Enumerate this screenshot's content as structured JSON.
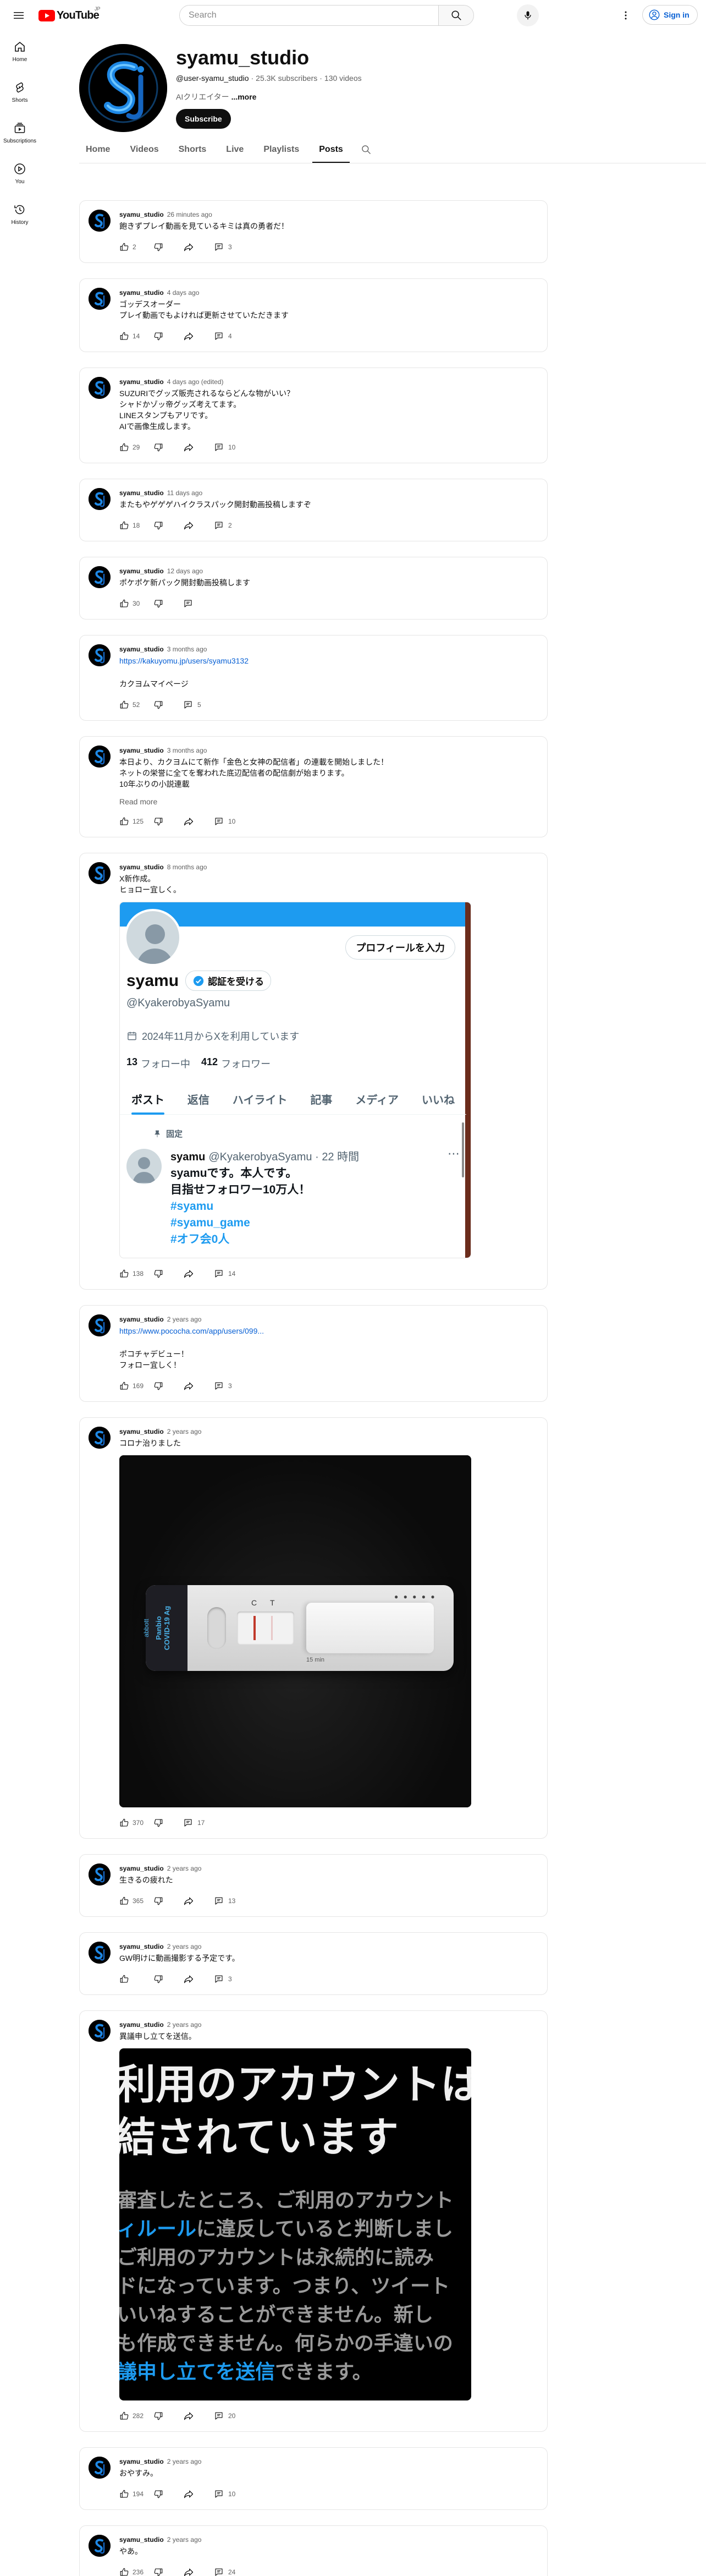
{
  "topbar": {
    "logo_text": "YouTube",
    "logo_region": "JP",
    "search_placeholder": "Search",
    "signin_label": "Sign in"
  },
  "guide": [
    {
      "label": "Home",
      "icon": "home-icon"
    },
    {
      "label": "Shorts",
      "icon": "shorts-icon"
    },
    {
      "label": "Subscriptions",
      "icon": "subscriptions-icon"
    },
    {
      "label": "You",
      "icon": "you-icon"
    },
    {
      "label": "History",
      "icon": "history-icon"
    }
  ],
  "channel": {
    "name": "syamu_studio",
    "handle": "@user-syamu_studio",
    "subscribers": "25.3K subscribers",
    "videos": "130 videos",
    "sep": "·",
    "description": "AIクリエイター",
    "more_label": "...more",
    "subscribe_label": "Subscribe",
    "avatar_letter": "Sj"
  },
  "tabs": [
    {
      "label": "Home",
      "active": false
    },
    {
      "label": "Videos",
      "active": false
    },
    {
      "label": "Shorts",
      "active": false
    },
    {
      "label": "Live",
      "active": false
    },
    {
      "label": "Playlists",
      "active": false
    },
    {
      "label": "Posts",
      "active": true
    }
  ],
  "posts": [
    {
      "author": "syamu_studio",
      "time": "26 minutes ago",
      "text": "飽きずプレイ動画を見ているキミは真の勇者だ！",
      "likes": "2",
      "comments": "3",
      "share": true
    },
    {
      "author": "syamu_studio",
      "time": "4 days ago",
      "text": "ゴッデスオーダー\nプレイ動画でもよければ更新させていただきます",
      "likes": "14",
      "comments": "4",
      "share": true
    },
    {
      "author": "syamu_studio",
      "time": "4 days ago (edited)",
      "text": "SUZURIでグッズ販売されるならどんな物がいい？\nシャドかゾッ帝グッズ考えてます。\nLINEスタンプもアリです。\nAIで画像生成します。",
      "likes": "29",
      "comments": "10",
      "share": true
    },
    {
      "author": "syamu_studio",
      "time": "11 days ago",
      "text": "またもやゲゲゲハイクラスパック開封動画投稿しますぞ",
      "likes": "18",
      "comments": "2",
      "share": true
    },
    {
      "author": "syamu_studio",
      "time": "12 days ago",
      "text": "ポケポケ新パック開封動画投稿します",
      "likes": "30",
      "comments": "",
      "share": false
    },
    {
      "author": "syamu_studio",
      "time": "3 months ago",
      "link": "https://kakuyomu.jp/users/syamu3132",
      "text": "カクヨムマイページ",
      "likes": "52",
      "comments": "5",
      "share": false
    },
    {
      "author": "syamu_studio",
      "time": "3 months ago",
      "text": "本日より、カクヨムにて新作「金色と女神の配信者」の連載を開始しました！\nネットの栄誉に全てを奪われた底辺配信者の配信劇が始まります。\n10年ぶりの小説連載",
      "read_more": "Read more",
      "likes": "125",
      "comments": "10",
      "share": true
    },
    {
      "author": "syamu_studio",
      "time": "8 months ago",
      "text": "X新作成。\nヒョロー宜しく。",
      "likes": "138",
      "comments": "14",
      "share": true,
      "x_profile": {
        "name": "syamu",
        "verify_label": "認証を受ける",
        "handle": "@KyakerobyaSyamu",
        "edit_label": "プロフィールを入力",
        "joined": "2024年11月からXを利用しています",
        "following_count": "13",
        "following_label": "フォロー中",
        "followers_count": "412",
        "followers_label": "フォロワー",
        "tabs": [
          "ポスト",
          "返信",
          "ハイライト",
          "記事",
          "メディア",
          "いいね"
        ],
        "pinned_label": "固定",
        "tweet_name": "syamu",
        "tweet_meta": "@KyakerobyaSyamu · 22 時間",
        "tweet_lines": [
          "syamuです。本人です。",
          "目指せフォロワー10万人！"
        ],
        "tweet_tags": [
          "#syamu",
          "#syamu_game",
          "#オフ会0人"
        ]
      }
    },
    {
      "author": "syamu_studio",
      "time": "2 years ago",
      "link": "https://www.pococha.com/app/users/099...",
      "text": "ポコチャデビュー！\nフォロー宜しく！",
      "likes": "169",
      "comments": "3",
      "share": true
    },
    {
      "author": "syamu_studio",
      "time": "2 years ago",
      "text": "コロナ治りました",
      "likes": "370",
      "comments": "17",
      "share": false,
      "covid_image": {
        "brand": "abbott",
        "product": "Panbio\nCOVID-19 Ag",
        "c_label": "C",
        "t_label": "T",
        "minutes": "15 min"
      }
    },
    {
      "author": "syamu_studio",
      "time": "2 years ago",
      "text": "生きるの疲れた",
      "likes": "365",
      "comments": "13",
      "share": true
    },
    {
      "author": "syamu_studio",
      "time": "2 years ago",
      "text": "GW明けに動画撮影する予定です。",
      "likes": "",
      "comments": "3",
      "share": true
    },
    {
      "author": "syamu_studio",
      "time": "2 years ago",
      "text": "異議申し立てを送信。",
      "likes": "282",
      "comments": "20",
      "share": true,
      "appeal_image": {
        "headline": [
          "利用のアカウントは",
          "結されています"
        ],
        "lines": [
          {
            "pre": "審査したところ、ご利用のアカウント",
            "hl": "",
            "post": ""
          },
          {
            "pre": "",
            "hl": "ィルール",
            "post": "に違反していると判断しまし"
          },
          {
            "pre": "ご利用のアカウントは永続的に読み",
            "hl": "",
            "post": ""
          },
          {
            "pre": "ドになっています。つまり、ツイート",
            "hl": "",
            "post": ""
          },
          {
            "pre": "いいねすることができません。新し",
            "hl": "",
            "post": ""
          },
          {
            "pre": "も作成できません。何らかの手違いの",
            "hl": "",
            "post": ""
          },
          {
            "pre": "",
            "hl": "議申し立てを送信",
            "post": "できます。"
          }
        ]
      }
    },
    {
      "author": "syamu_studio",
      "time": "2 years ago",
      "text": "おやすみ。",
      "likes": "194",
      "comments": "10",
      "share": true
    },
    {
      "author": "syamu_studio",
      "time": "2 years ago",
      "text": "やあ。",
      "likes": "236",
      "comments": "24",
      "share": true
    }
  ],
  "colors": {
    "link": "#065fd4",
    "x_blue": "#1d9bf0",
    "muted": "#606060"
  }
}
